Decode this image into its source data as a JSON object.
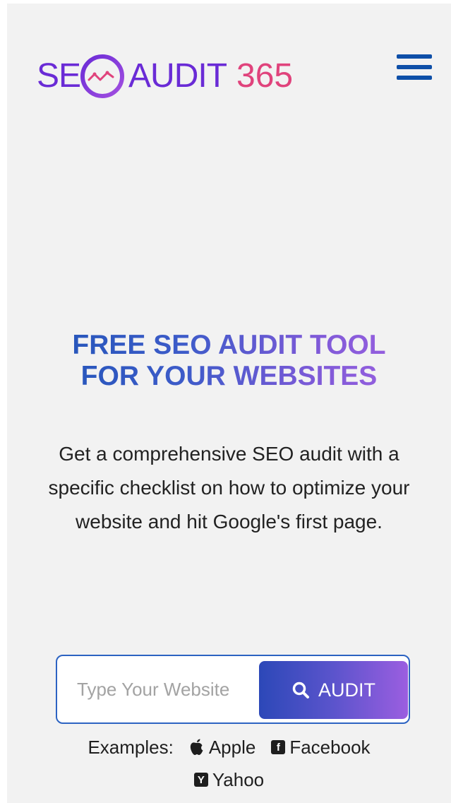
{
  "header": {
    "logo": {
      "part1": "SE",
      "part2": "AUDIT",
      "part3": "365"
    },
    "menu_icon": "hamburger-menu-icon"
  },
  "hero": {
    "title_line1": "FREE SEO AUDIT TOOL",
    "title_line2": "FOR YOUR WEBSITES",
    "description": "Get a comprehensive SEO audit with a specific checklist on how to optimize your website and hit Google's first page."
  },
  "search": {
    "placeholder": "Type Your Website",
    "button_label": "AUDIT",
    "button_icon": "search-icon"
  },
  "examples": {
    "label": "Examples:",
    "items": [
      {
        "label": "Apple",
        "icon": "apple-icon"
      },
      {
        "label": "Facebook",
        "icon": "facebook-icon"
      },
      {
        "label": "Yahoo",
        "icon": "yahoo-icon"
      }
    ]
  },
  "colors": {
    "brand_purple": "#6a2bd6",
    "brand_pink": "#e0437c",
    "menu_blue": "#0e4fa8",
    "button_gradient_start": "#2c48b8",
    "button_gradient_end": "#9b5ee0"
  }
}
